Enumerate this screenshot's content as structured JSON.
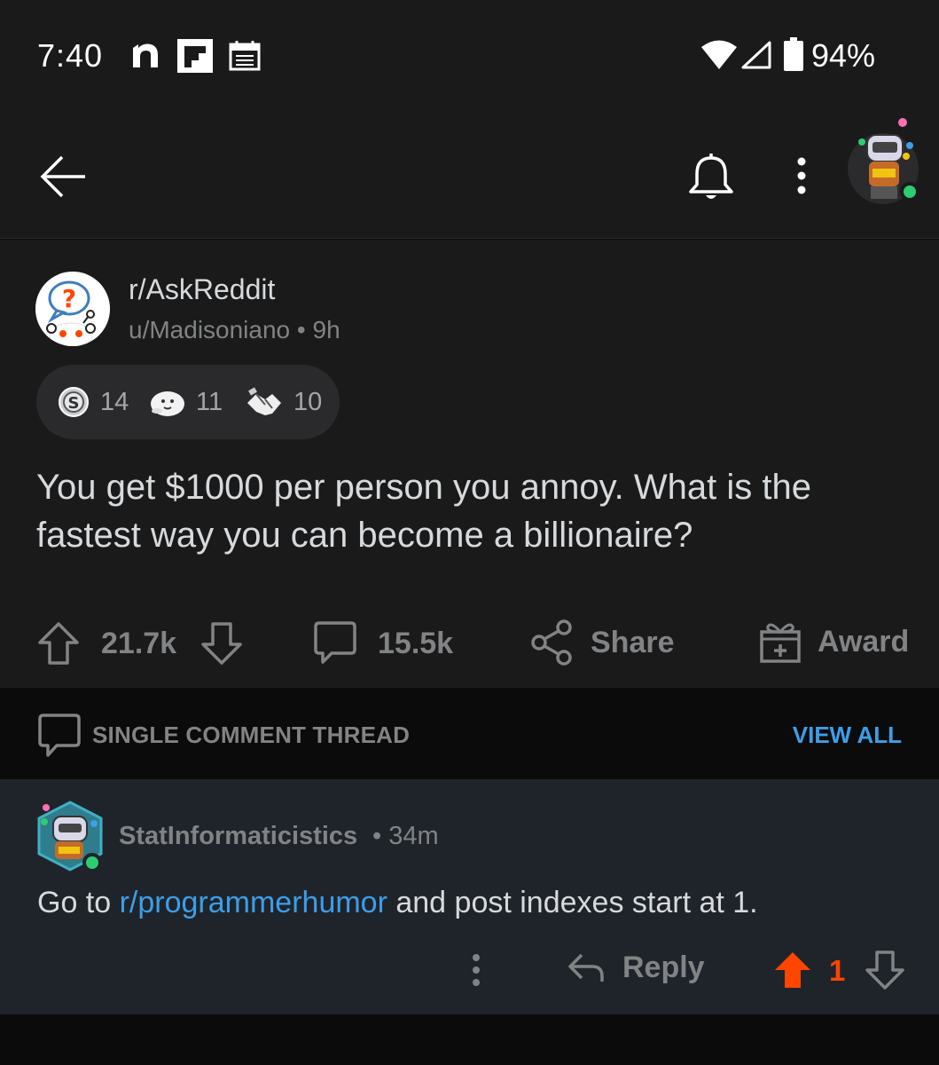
{
  "status_bar": {
    "time": "7:40",
    "battery": "94%",
    "left_icons": [
      "n-icon",
      "flipboard-icon",
      "calendar-icon"
    ],
    "right_icons": [
      "wifi-icon",
      "signal-icon",
      "battery-icon"
    ]
  },
  "header": {
    "icons": [
      "back-arrow-icon",
      "bell-icon",
      "more-vertical-icon",
      "user-avatar"
    ]
  },
  "post": {
    "subreddit": "r/AskReddit",
    "author": "u/Madisoniano",
    "time": "9h",
    "awards": [
      {
        "icon": "silver-award-icon",
        "count": "14"
      },
      {
        "icon": "wholesome-seal-award-icon",
        "count": "11"
      },
      {
        "icon": "handshake-award-icon",
        "count": "10"
      }
    ],
    "title": "You get $1000 per person you annoy. What is the fastest way you can become a billionaire?",
    "votes": "21.7k",
    "comments": "15.5k",
    "share_label": "Share",
    "award_label": "Award"
  },
  "thread_banner": {
    "label": "SINGLE COMMENT THREAD",
    "view_all": "VIEW ALL"
  },
  "comment": {
    "author": "StatInformaticistics",
    "time": "34m",
    "body_prefix": "Go to ",
    "body_link": "r/programmerhumor",
    "body_suffix": " and post indexes start at 1.",
    "reply_label": "Reply",
    "score": "1"
  },
  "colors": {
    "background": "#0b0b0c",
    "surface": "#1a1a1b",
    "comment_bg": "#1f242b",
    "link": "#3d9ee8",
    "upvote": "#ff4500",
    "online": "#2ecc71"
  }
}
